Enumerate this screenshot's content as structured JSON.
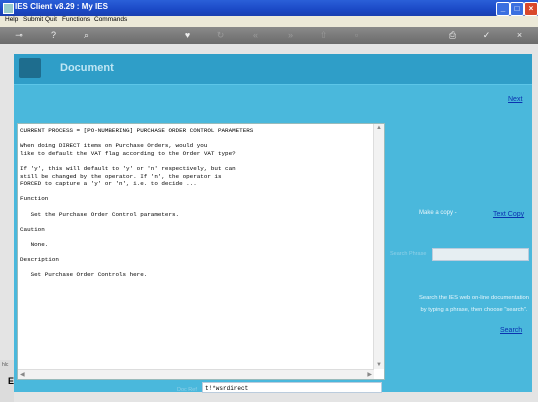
{
  "window": {
    "title": "IES Client v8.29 : My IES"
  },
  "menubar": {
    "items": [
      "Help",
      "Submit",
      "Quit",
      "Functions",
      "Commands"
    ]
  },
  "toolbar": {
    "icons": [
      "key-icon",
      "help-icon",
      "search-icon",
      "heart-icon",
      "refresh-icon",
      "rewind-icon",
      "forward-icon",
      "upload-icon",
      "page-icon",
      "print-icon",
      "check-icon",
      "close-icon"
    ]
  },
  "page": {
    "title": "Document",
    "next_link": "Next"
  },
  "document_text": "CURRENT PROCESS = [PO-NUMBERING] PURCHASE ORDER CONTROL PARAMETERS\n\nWhen doing DIRECT items on Purchase Orders, would you\nlike to default the VAT flag according to the Order VAT type?\n\nIf 'y', this will default to 'y' or 'n' respectively, but can\nstill be changed by the operator. If 'n', the operator is\nFORCED to capture a 'y' or 'n', i.e. to decide ...\n\nFunction\n\n   Set the Purchase Order Control parameters.\n\nCaution\n\n   None.\n\nDescription\n\n   Set Purchase Order Controls here.",
  "right_panel": {
    "make_copy_label": "Make a copy -",
    "text_copy_link": "Text Copy",
    "search_phrase_label": "Search Phrase",
    "search_phrase_value": "",
    "help_line1": "Search the IES web on-line documentation",
    "help_line2": "by typing a phrase, then choose \"search\".",
    "search_link": "Search"
  },
  "doc_ref": {
    "label": "Doc Ref",
    "value": "t!*wsrdirect"
  },
  "side_strip": {
    "top": "hlc",
    "bottom": "E"
  },
  "colors": {
    "stage": "#4ab8dc",
    "header": "#2f9ec8",
    "link": "#0b33b0"
  }
}
